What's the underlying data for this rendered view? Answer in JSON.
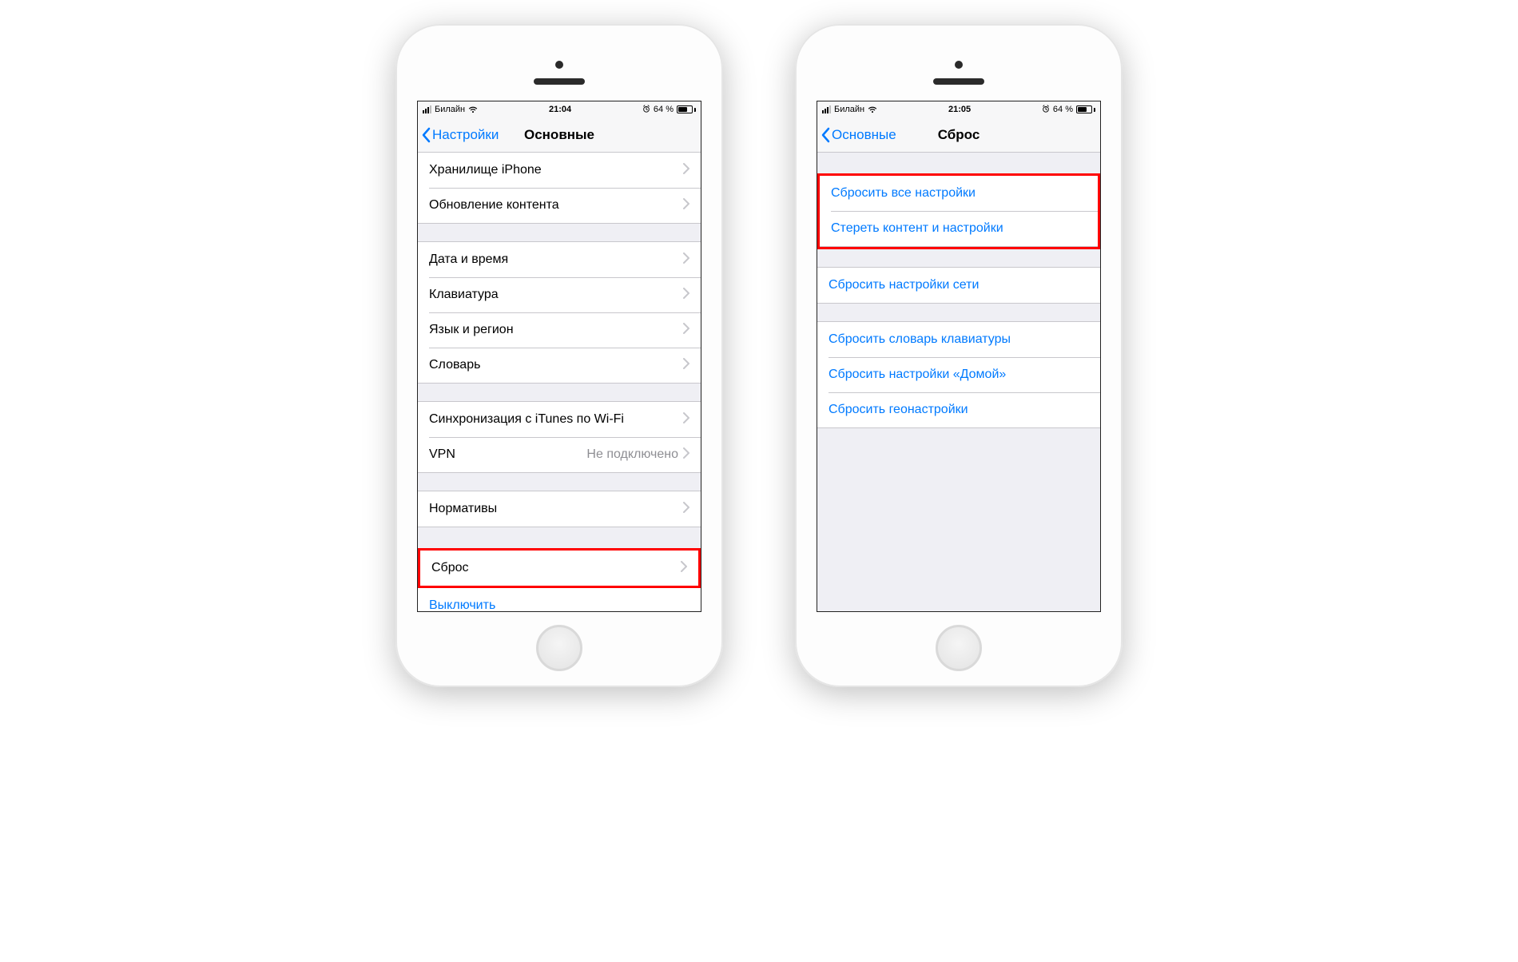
{
  "left": {
    "status": {
      "carrier": "Билайн",
      "time": "21:04",
      "battery": "64 %"
    },
    "nav": {
      "back": "Настройки",
      "title": "Основные"
    },
    "g1": {
      "storage": "Хранилище iPhone",
      "refresh": "Обновление контента"
    },
    "g2": {
      "datetime": "Дата и время",
      "keyboard": "Клавиатура",
      "lang": "Язык и регион",
      "dict": "Словарь"
    },
    "g3": {
      "itunes": "Синхронизация с iTunes по Wi-Fi",
      "vpn": "VPN",
      "vpn_value": "Не подключено"
    },
    "g4": {
      "regulatory": "Нормативы"
    },
    "g5": {
      "reset": "Сброс",
      "shutdown": "Выключить"
    }
  },
  "right": {
    "status": {
      "carrier": "Билайн",
      "time": "21:05",
      "battery": "64 %"
    },
    "nav": {
      "back": "Основные",
      "title": "Сброс"
    },
    "g1": {
      "reset_all": "Сбросить все настройки",
      "erase": "Стереть контент и настройки"
    },
    "g2": {
      "reset_net": "Сбросить настройки сети"
    },
    "g3": {
      "reset_kbd": "Сбросить словарь клавиатуры",
      "reset_home": "Сбросить настройки «Домой»",
      "reset_geo": "Сбросить геонастройки"
    }
  }
}
